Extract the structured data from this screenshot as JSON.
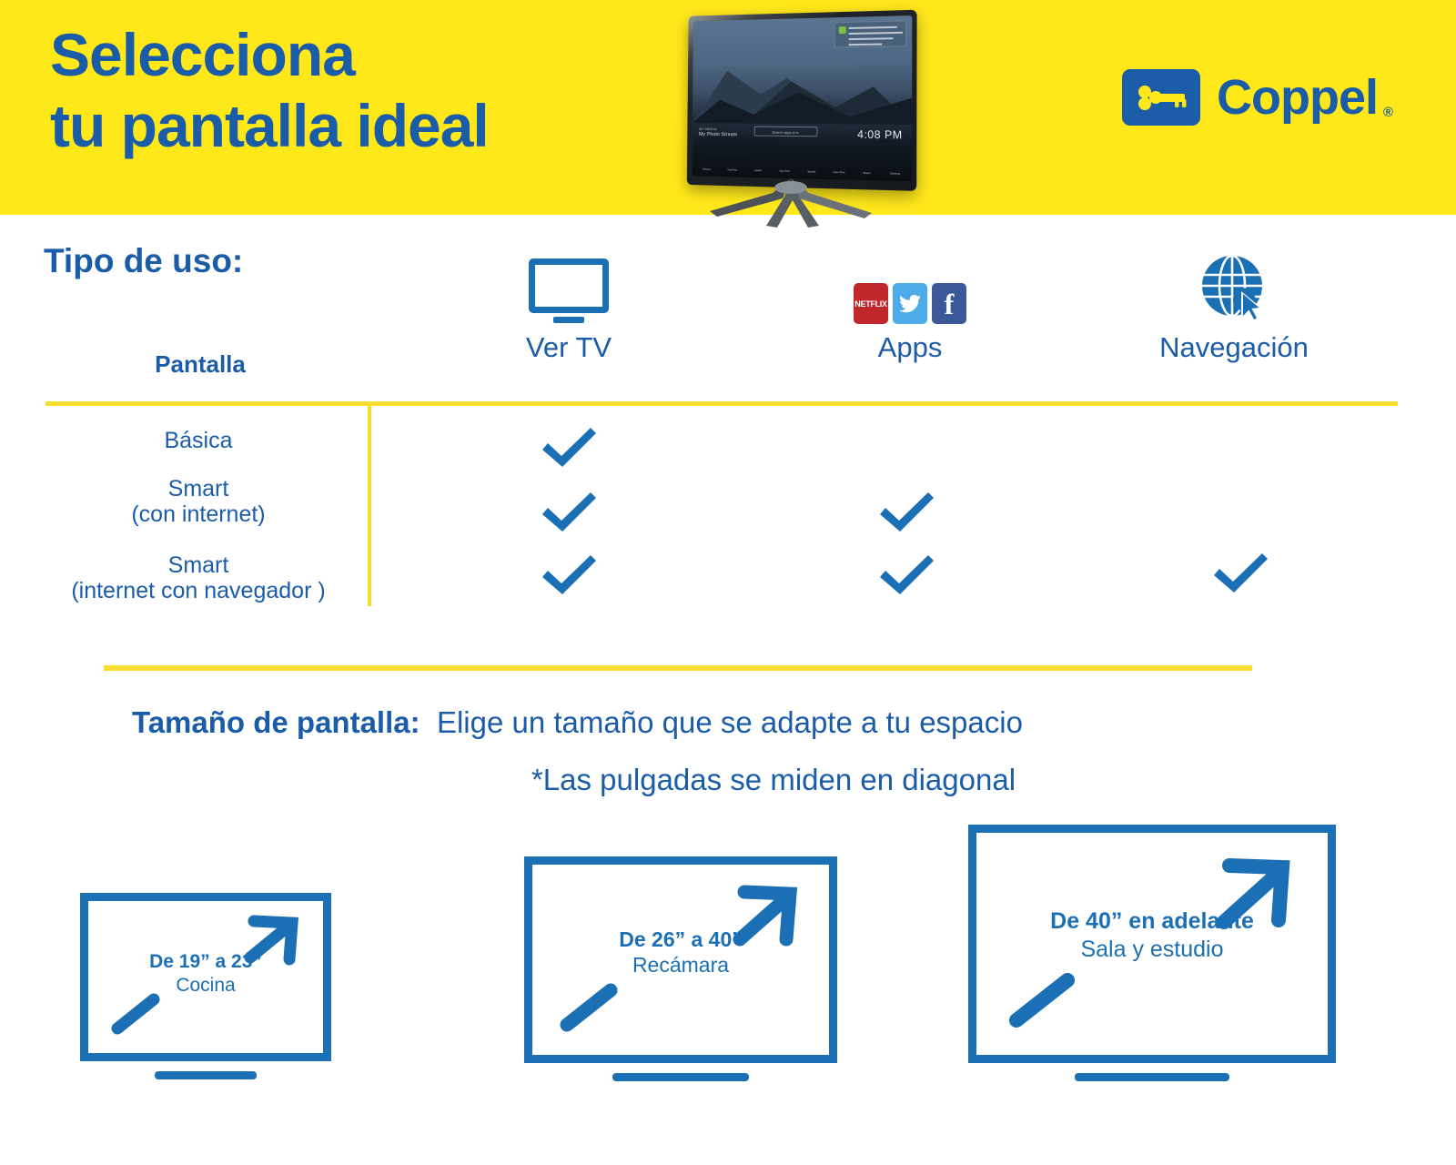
{
  "header": {
    "headline_line1": "Selecciona",
    "headline_line2": "tu pantalla ideal",
    "brand_name": "Coppel",
    "brand_registered": "®",
    "brand_badge_icon": "key-icon",
    "tv_image": {
      "label_small": "MY MEDIA",
      "label_main": "My Photo Stream",
      "search_placeholder": "Search apps & tv",
      "clock": "4:08 PM",
      "notification_title": "Mug's on the tv",
      "apps": [
        {
          "name": "Photos",
          "color": "#8fcbe8"
        },
        {
          "name": "YouTube",
          "color": "#cc1111"
        },
        {
          "name": "Netflix",
          "color": "#d81f26"
        },
        {
          "name": "Sky Plus",
          "color": "#2d9be0"
        },
        {
          "name": "Spotify",
          "color": "#84c441"
        },
        {
          "name": "Hulu Plus",
          "color": "#66bb3a"
        },
        {
          "name": "Skype",
          "color": "#2aa3e0"
        },
        {
          "name": "Settings",
          "color": "#e8e8e8"
        }
      ]
    }
  },
  "usage_section": {
    "title": "Tipo de uso:",
    "columns": [
      {
        "label": "Pantalla",
        "icon": "none"
      },
      {
        "label": "Ver TV",
        "icon": "monitor-icon"
      },
      {
        "label": "Apps",
        "icon": "app-logos-icon"
      },
      {
        "label": "Navegación",
        "icon": "globe-cursor-icon"
      }
    ],
    "app_logo_labels": {
      "netflix": "NETFLIX",
      "twitter": "twitter-bird",
      "facebook": "f"
    },
    "rows": [
      {
        "label_line1": "Básica",
        "label_line2": "",
        "checks": [
          true,
          false,
          false
        ]
      },
      {
        "label_line1": "Smart",
        "label_line2": "(con internet)",
        "checks": [
          true,
          true,
          false
        ]
      },
      {
        "label_line1": "Smart",
        "label_line2": "(internet con navegador )",
        "checks": [
          true,
          true,
          true
        ]
      }
    ]
  },
  "size_section": {
    "title": "Tamaño de pantalla:",
    "subtitle": "Elige un tamaño que se adapte a tu espacio",
    "note": "*Las pulgadas se miden en diagonal",
    "boxes": [
      {
        "size": "De 19” a 23”",
        "room": "Cocina"
      },
      {
        "size": "De 26” a 40”",
        "room": "Recámara"
      },
      {
        "size": "De 40” en adelante",
        "room": "Sala y estudio"
      }
    ]
  },
  "colors": {
    "brand_yellow": "#FFE81A",
    "rule_yellow": "#F7DE2E",
    "brand_blue": "#1B5CA8",
    "icon_blue": "#1B6FB5",
    "netflix_red": "#C0272D",
    "twitter_blue": "#4EABE9",
    "facebook_blue": "#3B5998",
    "background": "#FFFFFF"
  }
}
